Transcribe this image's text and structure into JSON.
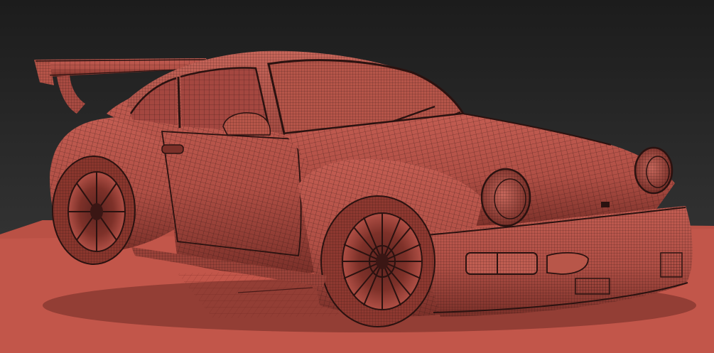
{
  "viewport": {
    "background_top": "#1e1e1e",
    "background_bottom": "#3a3a3a",
    "ground_color": "#c2564a",
    "mesh_fill": "#b25148",
    "mesh_fill_light": "#c45e52",
    "mesh_fill_dark": "#6e2c26",
    "wire_color": "#2a1210",
    "glass_color": "#a24740",
    "wheel_dark": "#3a1614"
  }
}
